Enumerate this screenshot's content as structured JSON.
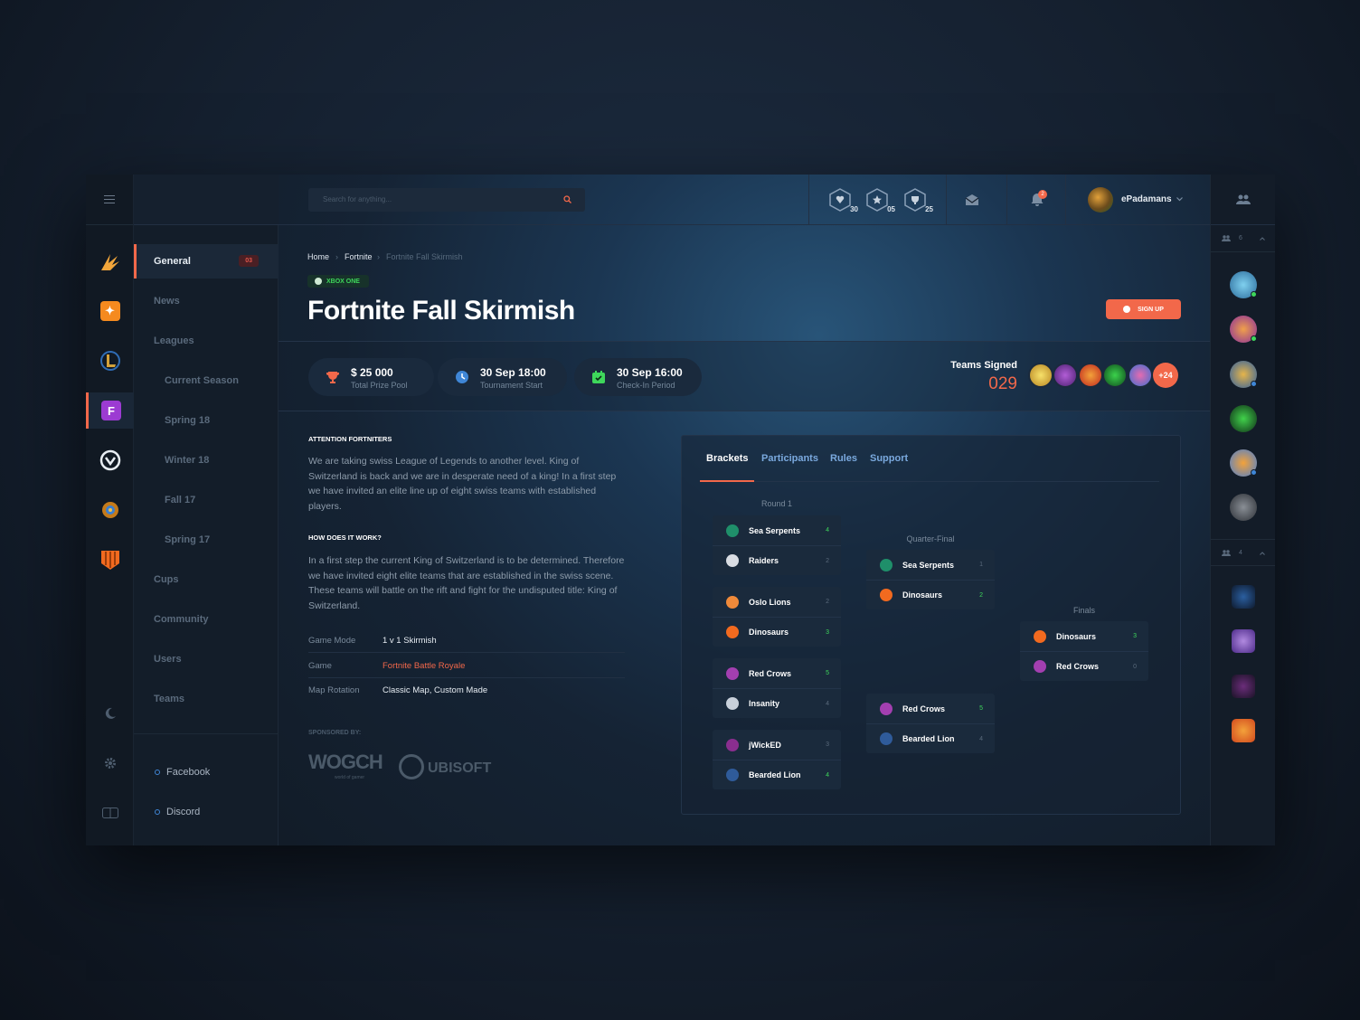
{
  "header": {
    "search_placeholder": "Search for anything...",
    "achievements": [
      {
        "icon": "heart-hex-icon",
        "count": "30"
      },
      {
        "icon": "star-hex-icon",
        "count": "05"
      },
      {
        "icon": "trophy-hex-icon",
        "count": "25"
      }
    ],
    "notification_count": "2",
    "username": "ePadamans"
  },
  "nav": {
    "items": [
      {
        "label": "General",
        "badge": "03",
        "active": true
      },
      {
        "label": "News"
      },
      {
        "label": "Leagues"
      },
      {
        "label": "Current Season",
        "sub": true
      },
      {
        "label": "Spring 18",
        "sub": true
      },
      {
        "label": "Winter 18",
        "sub": true
      },
      {
        "label": "Fall 17",
        "sub": true
      },
      {
        "label": "Spring 17",
        "sub": true
      },
      {
        "label": "Cups"
      },
      {
        "label": "Community"
      },
      {
        "label": "Users"
      },
      {
        "label": "Teams"
      }
    ],
    "social": [
      "Facebook",
      "Discord"
    ]
  },
  "game_icons": [
    "valorant-icon",
    "counter-strike-icon",
    "league-of-legends-icon",
    "fortnite-icon",
    "overwatch-icon",
    "hearthstone-icon",
    "call-of-duty-icon"
  ],
  "breadcrumb": [
    "Home",
    "Fortnite",
    "Fortnite Fall Skirmish"
  ],
  "platform_badge": "XBOX ONE",
  "title": "Fortnite Fall Skirmish",
  "signup_label": "SIGN UP",
  "stats": [
    {
      "value": "$ 25 000",
      "label": "Total Prize Pool",
      "icon": "trophy-icon"
    },
    {
      "value": "30 Sep 18:00",
      "label": "Tournament Start",
      "icon": "clock-icon"
    },
    {
      "value": "30 Sep 16:00",
      "label": "Check-In Period",
      "icon": "calendar-check-icon"
    }
  ],
  "teams_signed": {
    "label": "Teams Signed",
    "count": "029",
    "more": "+24"
  },
  "about": {
    "heading1": "ATTENTION FORTNITERS",
    "p1": "We are taking swiss League of Legends to another level.  King of Switzerland is back and we are in desperate need of a king! In a first step we have invited an elite line up of eight swiss teams with established players.",
    "heading2": "HOW DOES IT WORK?",
    "p2": "In a first step the current King of Switzerland is to be determined. Therefore we have invited eight elite teams that are established in the swiss scene. These teams will battle on the rift and fight for the undisputed title: King of Switzerland.",
    "info": [
      {
        "key": "Game Mode",
        "value": "1 v 1 Skirmish"
      },
      {
        "key": "Game",
        "value": "Fortnite Battle Royale"
      },
      {
        "key": "Map Rotation",
        "value": "Classic Map, Custom Made"
      }
    ],
    "sponsored_by": "SPONSORED BY:",
    "sponsors": [
      "WOGCH",
      "UBISOFT"
    ],
    "sponsor_tagline": "world of gamer"
  },
  "tabs": [
    "Brackets",
    "Participants",
    "Rules",
    "Support"
  ],
  "bracket": {
    "round1_label": "Round 1",
    "quarter_label": "Quarter-Final",
    "finals_label": "Finals",
    "round1": [
      [
        {
          "team": "Sea Serpents",
          "score": "4",
          "win": true
        },
        {
          "team": "Raiders",
          "score": "2",
          "win": false
        }
      ],
      [
        {
          "team": "Oslo Lions",
          "score": "2",
          "win": false
        },
        {
          "team": "Dinosaurs",
          "score": "3",
          "win": true
        }
      ],
      [
        {
          "team": "Red Crows",
          "score": "5",
          "win": true
        },
        {
          "team": "Insanity",
          "score": "4",
          "win": false
        }
      ],
      [
        {
          "team": "jWickED",
          "score": "3",
          "win": false
        },
        {
          "team": "Bearded Lion",
          "score": "4",
          "win": true
        }
      ]
    ],
    "quarter": [
      [
        {
          "team": "Sea Serpents",
          "score": "1",
          "win": false
        },
        {
          "team": "Dinosaurs",
          "score": "2",
          "win": true
        }
      ],
      [
        {
          "team": "Red Crows",
          "score": "5",
          "win": true
        },
        {
          "team": "Bearded Lion",
          "score": "4",
          "win": false
        }
      ]
    ],
    "finals": [
      [
        {
          "team": "Dinosaurs",
          "score": "3",
          "win": true
        },
        {
          "team": "Red Crows",
          "score": "0",
          "win": false
        }
      ]
    ]
  },
  "right_panel": {
    "friends_count": "6",
    "teams_count": "4"
  }
}
